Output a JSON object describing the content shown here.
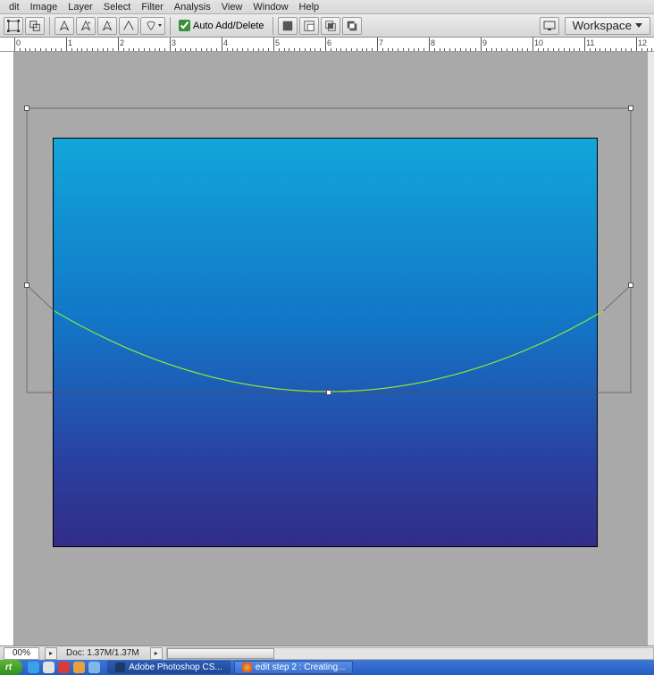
{
  "menu": [
    "dit",
    "Image",
    "Layer",
    "Select",
    "Filter",
    "Analysis",
    "View",
    "Window",
    "Help"
  ],
  "options": {
    "auto_add_delete_label": "Auto Add/Delete",
    "auto_add_delete_checked": true,
    "workspace_label": "Workspace"
  },
  "ruler": {
    "labels": [
      "0",
      "1",
      "2",
      "3",
      "4",
      "5",
      "6",
      "7",
      "8",
      "9",
      "10",
      "11",
      "12"
    ]
  },
  "status": {
    "zoom": "00%",
    "doc_info": "Doc: 1.37M/1.37M"
  },
  "taskbar": {
    "start_label": "rt",
    "task1_label": "Adobe Photoshop CS...",
    "task2_label": "edit step 2 : Creating..."
  }
}
